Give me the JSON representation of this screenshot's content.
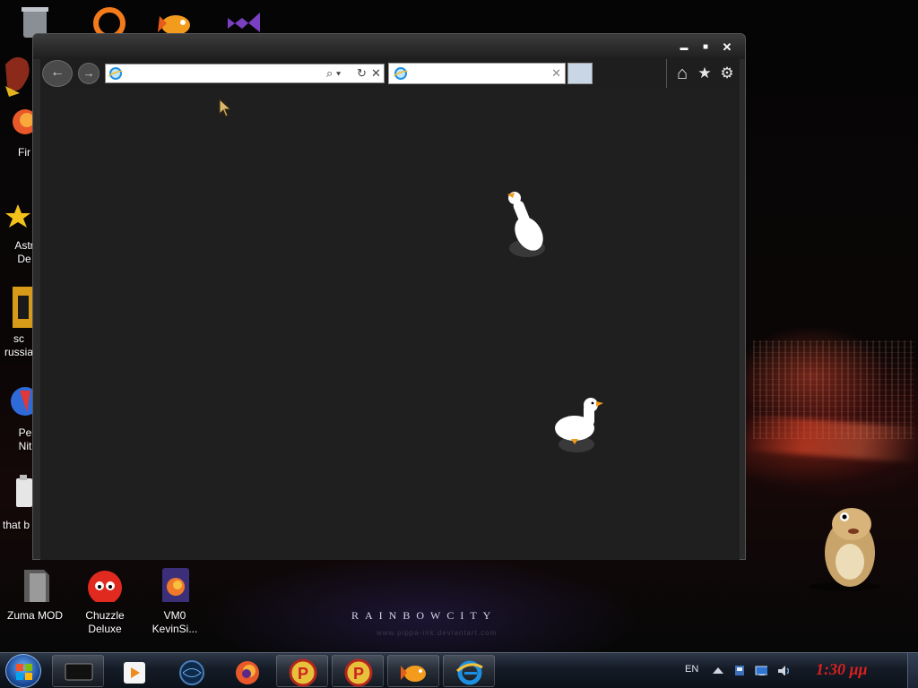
{
  "desktop": {
    "wallpaper_caption": "RAINBOWCITY",
    "wallpaper_url": "www.pippa-ink.deviantart.com",
    "icons": [
      {
        "label": "Fir"
      },
      {
        "label": "Astr De"
      },
      {
        "label": "sc russia"
      },
      {
        "label": "Pe Nit"
      },
      {
        "label": "that b"
      },
      {
        "label": "Zuma MOD"
      },
      {
        "label": "Chuzzle Deluxe"
      },
      {
        "label": "VM0 KevinSi..."
      }
    ]
  },
  "browser": {
    "address_value": "",
    "tab_title": "",
    "caption_buttons": {
      "minimize": "▬",
      "maximize": "■",
      "close": "✕"
    },
    "nav": {
      "back": "←",
      "forward": "→"
    },
    "address_actions": {
      "search": "⌕ ▾",
      "refresh": "↻",
      "stop": "✕"
    },
    "tab_close": "✕",
    "toolbar": {
      "home": "⌂",
      "favorites": "★",
      "tools": "⚙"
    }
  },
  "taskbar": {
    "items": [
      {
        "name": "start-button-icon"
      },
      {
        "name": "task-manager-icon"
      },
      {
        "name": "media-player-icon"
      },
      {
        "name": "globe-app-icon"
      },
      {
        "name": "firefox-icon"
      },
      {
        "name": "pinball-p-icon"
      },
      {
        "name": "pinball-p-icon-2"
      },
      {
        "name": "goldfish-icon"
      },
      {
        "name": "internet-explorer-icon"
      }
    ],
    "tray": {
      "language": "EN",
      "clock": "1:30 μμ"
    }
  },
  "colors": {
    "clock": "#d92020",
    "browser_content": "#1f1f1f",
    "taskbar": "#141b26"
  }
}
